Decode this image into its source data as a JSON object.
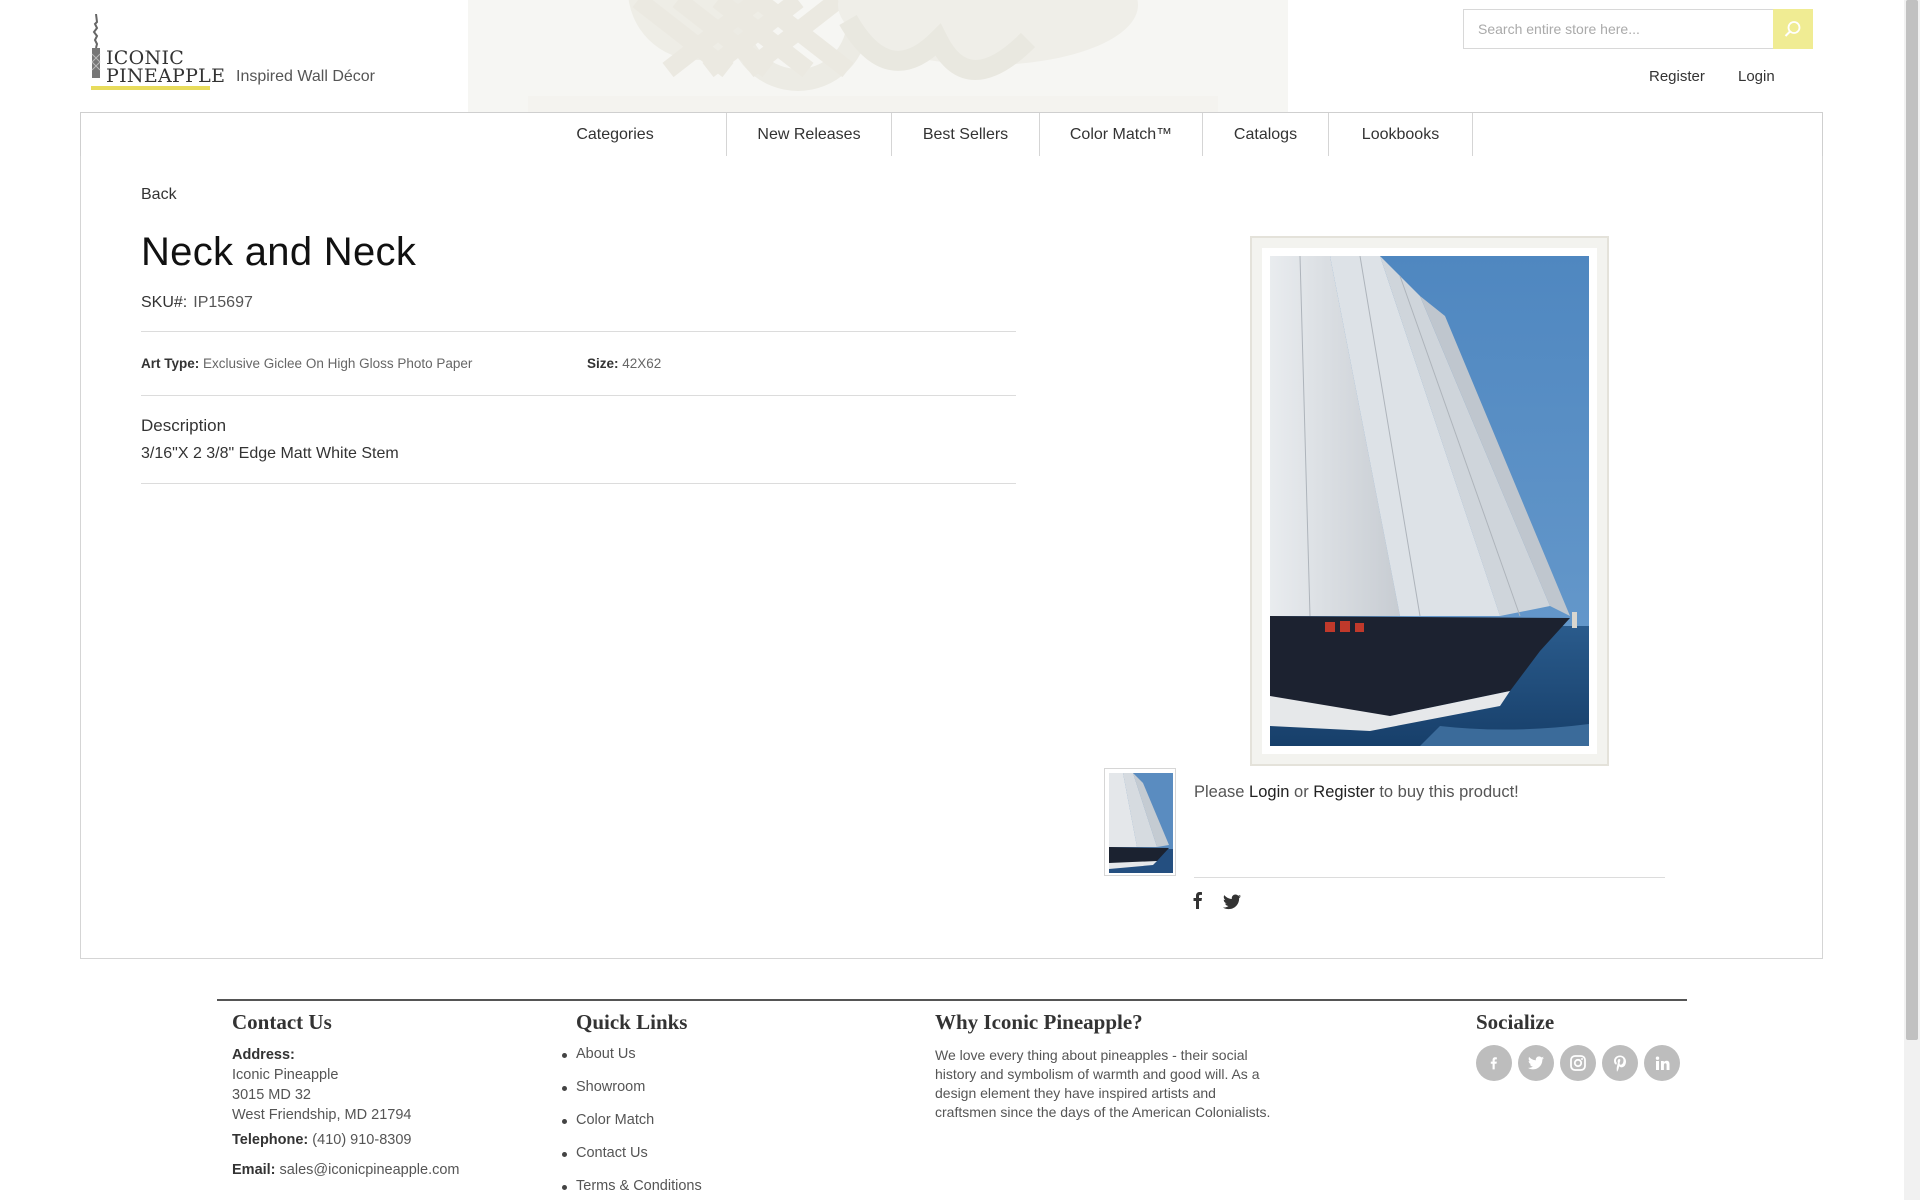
{
  "header": {
    "logo_line1": "ICONIC",
    "logo_line2": "PINEAPPLE",
    "tagline": "Inspired Wall Décor",
    "search_placeholder": "Search entire store here...",
    "search_icon": "search-icon",
    "register": "Register",
    "login": "Login"
  },
  "nav": {
    "items": [
      "Categories",
      "New Releases",
      "Best Sellers",
      "Color Match™",
      "Catalogs",
      "Lookbooks"
    ]
  },
  "product": {
    "back": "Back",
    "title": "Neck and Neck",
    "sku_label": "SKU#:",
    "sku": "IP15697",
    "art_type_label": "Art Type:",
    "art_type": "Exclusive Giclee On High Gloss Photo Paper",
    "size_label": "Size:",
    "size": "42X62",
    "description_title": "Description",
    "description": "3/16\"X 2 3/8\" Edge Matt White Stem",
    "buy_please": "Please",
    "buy_login": "Login",
    "buy_or": "or",
    "buy_register": "Register",
    "buy_suffix": "to buy this product!",
    "share_icons": [
      "facebook-icon",
      "twitter-icon"
    ]
  },
  "footer": {
    "contact": {
      "title": "Contact Us",
      "address_label": "Address:",
      "address_line1": "Iconic Pineapple",
      "address_line2": "3015 MD 32",
      "address_line3": "West Friendship, MD 21794",
      "telephone_label": "Telephone:",
      "telephone": "(410) 910-8309",
      "email_label": "Email:",
      "email": "sales@iconicpineapple.com"
    },
    "quick_links": {
      "title": "Quick Links",
      "items": [
        "About Us",
        "Showroom",
        "Color Match",
        "Contact Us",
        "Terms & Conditions"
      ]
    },
    "why": {
      "title": "Why Iconic Pineapple?",
      "text": "We love every thing about pineapples - their social history and symbolism of warmth and good will. As a design element they have inspired artists and craftsmen since the days of the American Colonialists."
    },
    "socialize": {
      "title": "Socialize",
      "icons": [
        "facebook-icon",
        "twitter-icon",
        "instagram-icon",
        "pinterest-icon",
        "linkedin-icon"
      ]
    }
  },
  "colors": {
    "accent_yellow": "#f0ec93",
    "logo_yellow": "#e8dc5c",
    "sky_blue": "#5389c0",
    "sea_blue": "#214d7d",
    "social_grey": "#bdbdbd"
  }
}
